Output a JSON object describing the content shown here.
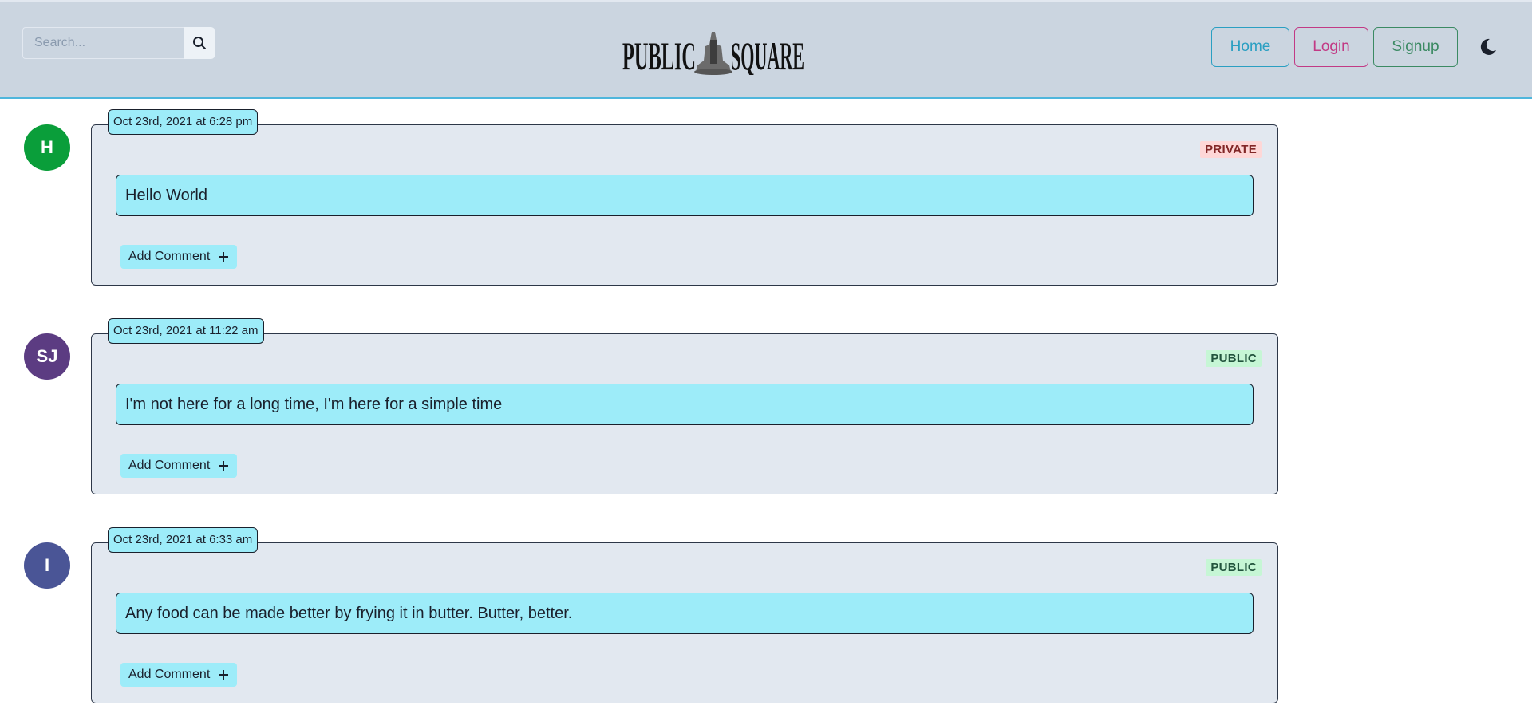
{
  "header": {
    "search_placeholder": "Search...",
    "search_icon": "search-icon",
    "logo_text": "PUBLIC SQUARE",
    "nav": {
      "home": "Home",
      "login": "Login",
      "signup": "Signup"
    },
    "theme_icon": "moon-icon",
    "colors": {
      "background": "#cbd5e0",
      "home": "#2a9fc2",
      "login": "#c23a85",
      "signup": "#3b8a63"
    }
  },
  "posts": [
    {
      "initials": "H",
      "avatar_color": "#0a9e3a",
      "date": "Oct 23rd, 2021 at 6:28 pm",
      "visibility": "PRIVATE",
      "content": "Hello World",
      "add_comment": "Add Comment"
    },
    {
      "initials": "SJ",
      "avatar_color": "#5c3c82",
      "date": "Oct 23rd, 2021 at 11:22 am",
      "visibility": "PUBLIC",
      "content": "I'm not here for a long time, I'm here for a simple time",
      "add_comment": "Add Comment"
    },
    {
      "initials": "I",
      "avatar_color": "#4a5596",
      "date": "Oct 23rd, 2021 at 6:33 am",
      "visibility": "PUBLIC",
      "content": "Any food can be made better by frying it in butter. Butter, better.",
      "add_comment": "Add Comment"
    }
  ]
}
